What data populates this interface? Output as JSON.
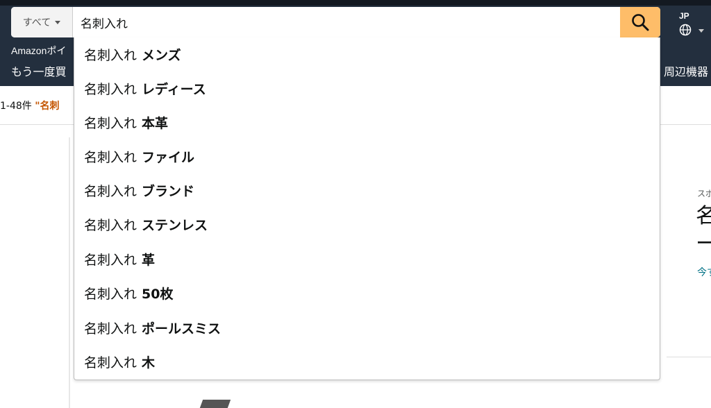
{
  "header": {
    "search_category": "すべて",
    "search_query": "名刺入れ",
    "language_code": "JP",
    "nav_line1_text": "Amazonポイ",
    "nav_line2_text": "もう一度買",
    "nav_right_text": "周辺機器"
  },
  "results": {
    "count_text": "1-48件",
    "query_text": "\"名刺"
  },
  "sponsored": {
    "label": "スポ",
    "title_line1": "名",
    "title_line2": "ー",
    "link_text": "今す"
  },
  "suggestions": [
    {
      "base": "名刺入れ",
      "completion": "メンズ"
    },
    {
      "base": "名刺入れ",
      "completion": "レディース"
    },
    {
      "base": "名刺入れ",
      "completion": "本革"
    },
    {
      "base": "名刺入れ",
      "completion": "ファイル"
    },
    {
      "base": "名刺入れ",
      "completion": "ブランド"
    },
    {
      "base": "名刺入れ",
      "completion": "ステンレス"
    },
    {
      "base": "名刺入れ",
      "completion": "革"
    },
    {
      "base": "名刺入れ",
      "completion": "50枚"
    },
    {
      "base": "名刺入れ",
      "completion": "ポールスミス"
    },
    {
      "base": "名刺入れ",
      "completion": "木"
    }
  ],
  "colors": {
    "nav_bg": "#232f3e",
    "search_button": "#febd69",
    "results_query": "#c45500",
    "link": "#007185"
  },
  "icons": {
    "search": "search-icon",
    "globe": "globe-icon",
    "dropdown": "caret-down-icon"
  }
}
